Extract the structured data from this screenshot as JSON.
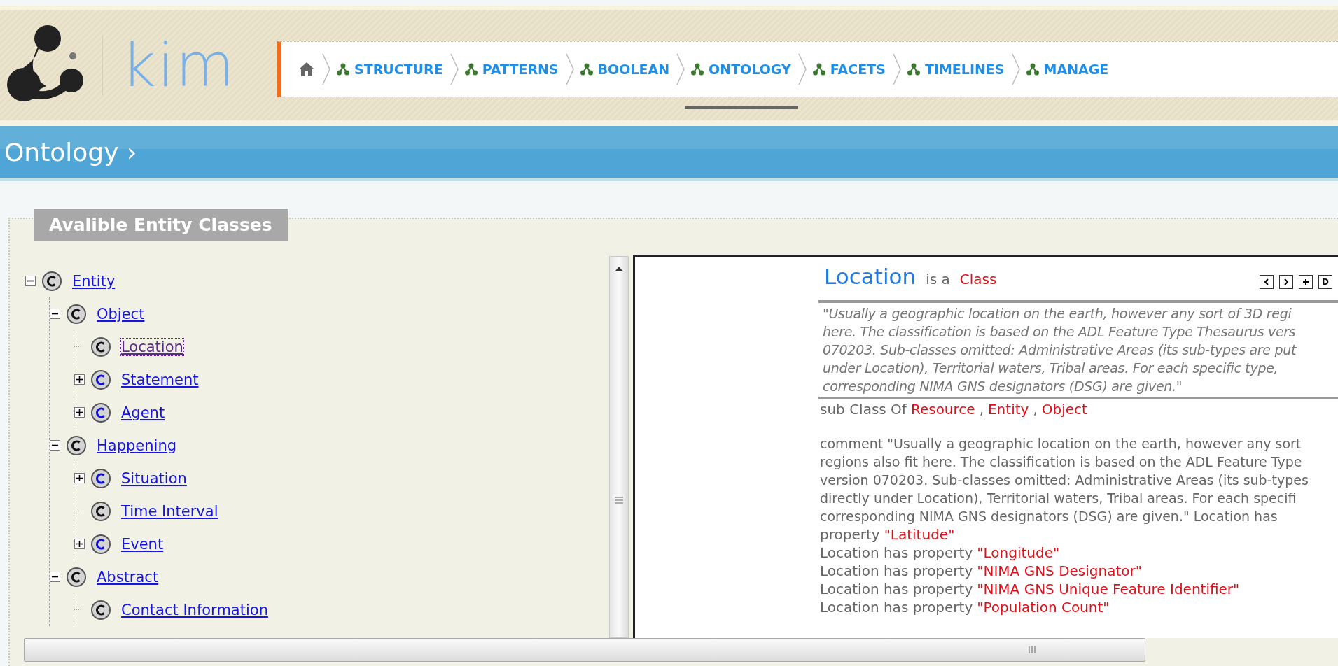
{
  "logo": {
    "text": "kim"
  },
  "nav": [
    {
      "kind": "home",
      "selected": false
    },
    {
      "kind": "link",
      "label": "STRUCTURE",
      "selected": false
    },
    {
      "kind": "link",
      "label": "PATTERNS",
      "selected": false
    },
    {
      "kind": "link",
      "label": "BOOLEAN",
      "selected": false
    },
    {
      "kind": "link",
      "label": "ONTOLOGY",
      "selected": true
    },
    {
      "kind": "link",
      "label": "FACETS",
      "selected": false
    },
    {
      "kind": "link",
      "label": "TIMELINES",
      "selected": false
    },
    {
      "kind": "link",
      "label": "MANAGE",
      "selected": false
    }
  ],
  "banner": {
    "title": "Ontology ›"
  },
  "classes_panel": {
    "title": "Avalible Entity Classes",
    "tree": [
      {
        "label": "Entity",
        "kind": "expanded",
        "selected": false,
        "children": [
          {
            "label": "Object",
            "kind": "expanded",
            "selected": false,
            "children": [
              {
                "label": "Location",
                "kind": "leaf",
                "selected": true
              },
              {
                "label": "Statement",
                "kind": "collapsed",
                "selected": false
              },
              {
                "label": "Agent",
                "kind": "collapsed",
                "selected": false
              }
            ]
          },
          {
            "label": "Happening",
            "kind": "expanded",
            "selected": false,
            "children": [
              {
                "label": "Situation",
                "kind": "collapsed",
                "selected": false
              },
              {
                "label": "Time Interval",
                "kind": "leaf",
                "selected": false
              },
              {
                "label": "Event",
                "kind": "collapsed",
                "selected": false
              }
            ]
          },
          {
            "label": "Abstract",
            "kind": "expanded",
            "selected": false,
            "children": [
              {
                "label": "Contact Information",
                "kind": "leaf",
                "selected": false
              }
            ]
          }
        ]
      }
    ]
  },
  "detail": {
    "name": "Location",
    "is_a": "is a",
    "type": "Class",
    "buttons": [
      {
        "kind": "prev"
      },
      {
        "kind": "next"
      },
      {
        "kind": "add"
      },
      {
        "kind": "text",
        "label": "D"
      }
    ],
    "description": [
      "\"Usually a geographic location on the earth, however any sort of 3D regi",
      "here. The classification is based on the ADL Feature Type Thesaurus vers",
      "070203. Sub-classes omitted: Administrative Areas (its sub-types are put",
      "under Location), Territorial waters, Tribal areas. For each specific type,",
      "corresponding NIMA GNS designators (DSG) are given.\""
    ],
    "subclass_label": "sub Class Of",
    "subclass_of": [
      {
        "label": "Resource",
        "sep": ","
      },
      {
        "label": "Entity",
        "sep": ","
      },
      {
        "label": "Object"
      }
    ],
    "comment": [
      "comment \"Usually a geographic location on the earth, however any sort",
      "regions also fit here. The classification is based on the ADL Feature Type",
      "version 070203. Sub-classes omitted: Administrative Areas (its sub-types",
      "directly under Location), Territorial waters, Tribal areas. For each specifi",
      "corresponding NIMA GNS designators (DSG) are given.\" Location has"
    ],
    "properties": [
      {
        "prefix": "property",
        "value": "\"Latitude\""
      },
      {
        "prefix": "Location has property",
        "value": "\"Longitude\""
      },
      {
        "prefix": "Location has property",
        "value": "\"NIMA GNS Designator\""
      },
      {
        "prefix": "Location has property",
        "value": "\"NIMA GNS Unique Feature Identifier\""
      },
      {
        "prefix": "Location has property",
        "value": "\"Population Count\""
      }
    ]
  }
}
